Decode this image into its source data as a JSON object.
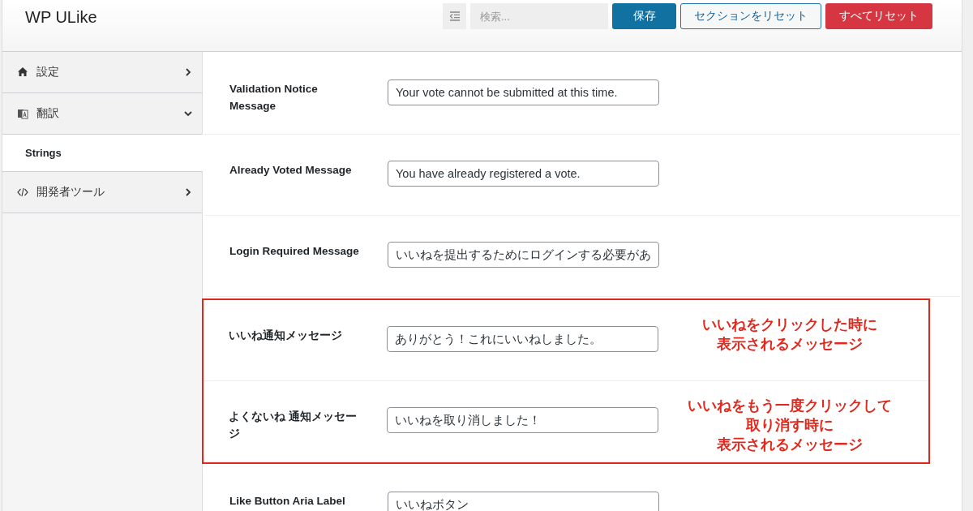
{
  "header": {
    "title": "WP ULike",
    "search": {
      "placeholder": "検索..."
    },
    "buttons": [
      {
        "label": "保存",
        "kind": "primary"
      },
      {
        "label": "セクションをリセット",
        "kind": "outline"
      },
      {
        "label": "すべてリセット",
        "kind": "danger"
      }
    ]
  },
  "sidebar": {
    "items": [
      {
        "label": "設定",
        "kind": "home",
        "expanded": false
      },
      {
        "label": "翻訳",
        "kind": "translate",
        "expanded": true,
        "children": [
          {
            "label": "Strings",
            "selected": true
          }
        ]
      },
      {
        "label": "開発者ツール",
        "kind": "code",
        "expanded": false
      }
    ]
  },
  "groups": [
    {
      "highlighted": false,
      "rows": [
        {
          "label": "Validation Notice Message",
          "value": "Your vote cannot be submitted at this time."
        },
        {
          "label": "Already Voted Message",
          "value": "You have already registered a vote."
        },
        {
          "label": "Login Required Message",
          "value": "いいねを提出するためにログインする必要があ"
        }
      ]
    },
    {
      "highlighted": true,
      "rows": [
        {
          "label": "いいね通知メッセージ",
          "value": "ありがとう！これにいいねしました。",
          "note": [
            "いいねをクリックした時に",
            "表示されるメッセージ"
          ]
        },
        {
          "label": "よくないね 通知メッセージ",
          "value": "いいねを取り消しました！",
          "note": [
            "いいねをもう一度クリックして",
            "取り消す時に",
            "表示されるメッセージ"
          ]
        }
      ]
    },
    {
      "highlighted": false,
      "rows": [
        {
          "label": "Like Button Aria Label",
          "value": "いいねボタン"
        }
      ]
    }
  ]
}
